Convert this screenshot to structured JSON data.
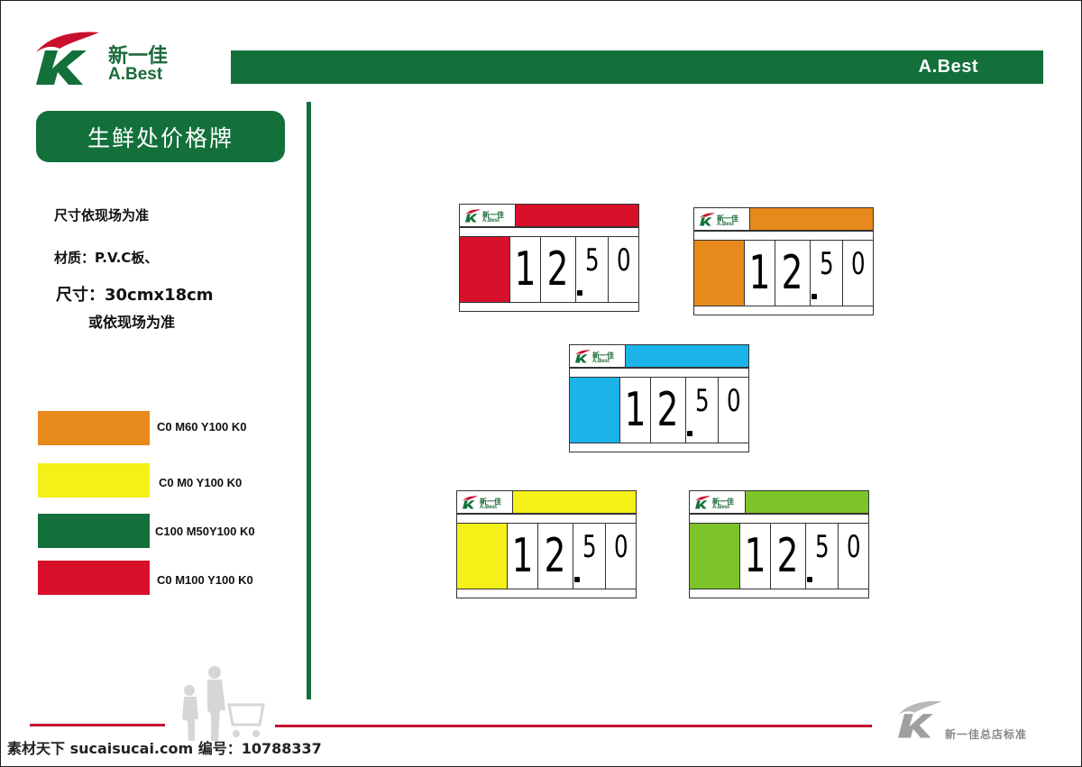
{
  "brand": {
    "name_cn": "新一佳",
    "name_en": "A.Best",
    "colors": {
      "green": "#13703b",
      "red": "#c8102e",
      "gray": "#9a9a9a"
    }
  },
  "header": {
    "bar_label": "A.Best"
  },
  "title": "生鲜处价格牌",
  "specs": {
    "line1": "尺寸依现场为准",
    "line2": "材质：P.V.C板、",
    "line3": "尺寸：30cmx18cm",
    "line4": "或依现场为准"
  },
  "swatches": [
    {
      "label": "C0 M60 Y100  K0",
      "color": "#e8891c"
    },
    {
      "label": "C0 M0 Y100  K0",
      "color": "#f6f019"
    },
    {
      "label": "C100 M50Y100 K0",
      "color": "#13703b"
    },
    {
      "label": "C0 M100 Y100 K0",
      "color": "#d8102a"
    }
  ],
  "tags": [
    {
      "color": "#d8102a",
      "digits": [
        "1",
        "2",
        "5",
        "0"
      ]
    },
    {
      "color": "#e8891c",
      "digits": [
        "1",
        "2",
        "5",
        "0"
      ]
    },
    {
      "color": "#1ab4e8",
      "digits": [
        "1",
        "2",
        "5",
        "0"
      ]
    },
    {
      "color": "#f6f019",
      "digits": [
        "1",
        "2",
        "5",
        "0"
      ]
    },
    {
      "color": "#7dc42a",
      "digits": [
        "1",
        "2",
        "5",
        "0"
      ]
    }
  ],
  "footer": {
    "watermark": "素材天下 sucaisucai.com  编号：10788337",
    "standard_label": "新一佳总店标准"
  }
}
